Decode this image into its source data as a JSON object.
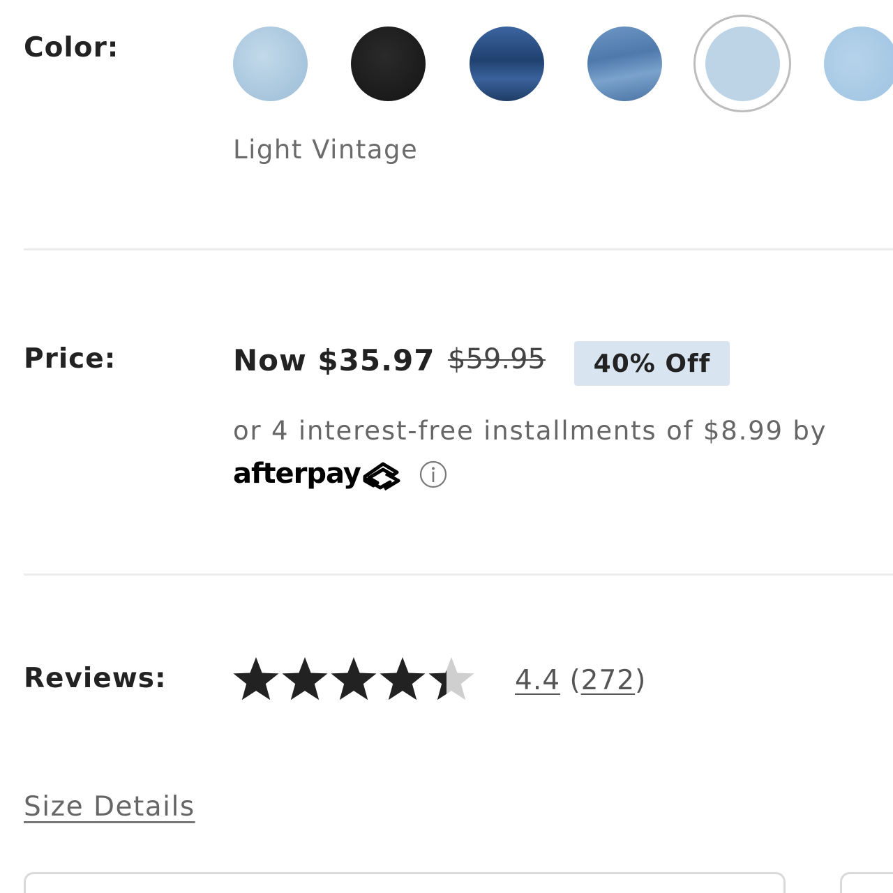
{
  "color": {
    "label": "Color:",
    "selected_name": "Light Vintage",
    "swatches": [
      {
        "name": "light-wash",
        "color": "#a9c8de"
      },
      {
        "name": "black",
        "color": "#1e1e1e"
      },
      {
        "name": "dark-wash",
        "color": "#2f5586"
      },
      {
        "name": "medium-wash",
        "color": "#5b86b5"
      },
      {
        "name": "light-vintage",
        "color": "#bdd4e6",
        "selected": true
      },
      {
        "name": "sky-wash",
        "color": "#a8cae6"
      }
    ]
  },
  "price": {
    "label": "Price:",
    "now": "Now $35.97",
    "was": "$59.95",
    "discount": "40% Off",
    "installments_text": "or 4 interest-free installments of $8.99 by",
    "provider": "afterpay"
  },
  "reviews": {
    "label": "Reviews:",
    "rating": "4.4",
    "count": "272",
    "stars_filled": 4.4,
    "stars_total": 5
  },
  "size_details": {
    "label": "Size Details"
  },
  "colors": {
    "star_filled": "#222222",
    "star_empty": "#cfcfcf",
    "badge_bg": "#d8e5f0"
  }
}
